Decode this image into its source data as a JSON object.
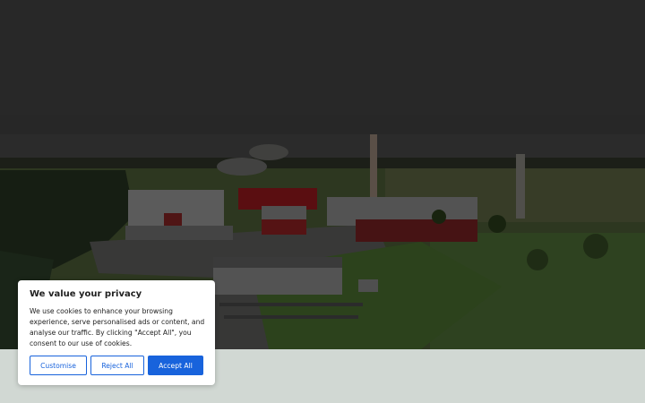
{
  "hero": {
    "title": "",
    "image_subject": "aerial view of industrial factory site with chimneys"
  },
  "colors": {
    "accent": "#1863dc",
    "banner_bg": "#ffffff",
    "page_bg": "#eef6f1"
  },
  "cookie_banner": {
    "title": "We value your privacy",
    "text": "We use cookies to enhance your browsing experience, serve personalised ads or content, and analyse our traffic. By clicking \"Accept All\", you consent to our use of cookies.",
    "customise_label": "Customise",
    "reject_label": "Reject All",
    "accept_label": "Accept All"
  }
}
